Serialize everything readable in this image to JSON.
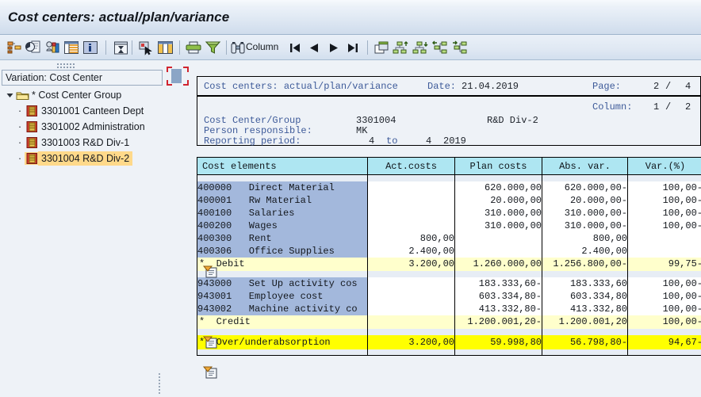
{
  "window": {
    "title": "Cost centers: actual/plan/variance"
  },
  "toolbar": {
    "icons": [
      {
        "name": "hierarchy-icon",
        "label": ""
      },
      {
        "name": "variation-icon",
        "label": ""
      },
      {
        "name": "report-structure-icon",
        "label": ""
      },
      {
        "name": "table-icon",
        "label": ""
      },
      {
        "name": "info-icon",
        "label": ""
      },
      {
        "name": "sort-filter-icon",
        "label": ""
      },
      {
        "name": "select-cursor-icon",
        "label": ""
      },
      {
        "name": "columns-icon",
        "label": ""
      },
      {
        "name": "print-icon",
        "label": ""
      },
      {
        "name": "filter-funnel-icon",
        "label": ""
      },
      {
        "name": "find-binoculars-icon",
        "label": "Column"
      },
      {
        "name": "first-page-icon",
        "label": ""
      },
      {
        "name": "previous-page-icon",
        "label": ""
      },
      {
        "name": "next-page-icon",
        "label": ""
      },
      {
        "name": "last-page-icon",
        "label": ""
      },
      {
        "name": "new-window-icon",
        "label": ""
      },
      {
        "name": "expand-up-icon",
        "label": ""
      },
      {
        "name": "collapse-down-icon",
        "label": ""
      },
      {
        "name": "navigate-left-icon",
        "label": ""
      },
      {
        "name": "navigate-right-icon",
        "label": ""
      }
    ],
    "find_label": "Column"
  },
  "sidebar": {
    "header": "Variation: Cost Center",
    "root": {
      "label": "* Cost Center Group",
      "expanded": true
    },
    "items": [
      {
        "id": "3301001",
        "label": "3301001 Canteen Dept",
        "selected": false
      },
      {
        "id": "3301002",
        "label": "3301002 Administration",
        "selected": false
      },
      {
        "id": "3301003",
        "label": "3301003 R&D Div-1",
        "selected": false
      },
      {
        "id": "3301004",
        "label": "3301004 R&D Div-2",
        "selected": true
      }
    ]
  },
  "report_header": {
    "title": "Cost centers: actual/plan/variance",
    "date_label": "Date:",
    "date_value": "21.04.2019",
    "page_label": "Page:",
    "page_current": "2",
    "page_sep": "/",
    "page_total": "4",
    "column_label": "Column:",
    "column_current": "1",
    "column_sep": "/",
    "column_total": "2",
    "cost_center_label": "Cost Center/Group",
    "cost_center_value": "3301004",
    "cost_center_name": "R&D Div-2",
    "person_label": "Person responsible:",
    "person_value": "MK",
    "period_label": "Reporting period:",
    "period_from": "4",
    "period_to_word": "to",
    "period_to": "4",
    "period_year": "2019"
  },
  "table": {
    "columns": [
      "Cost elements",
      "Act.costs",
      "Plan costs",
      "Abs. var.",
      "Var.(%)"
    ],
    "groups": [
      {
        "rows": [
          {
            "code": "400000",
            "name": "Direct Material",
            "act": "",
            "plan": "620.000,00",
            "abs": "620.000,00-",
            "var": "100,00-"
          },
          {
            "code": "400001",
            "name": "Rw Material",
            "act": "",
            "plan": "20.000,00",
            "abs": "20.000,00-",
            "var": "100,00-"
          },
          {
            "code": "400100",
            "name": "Salaries",
            "act": "",
            "plan": "310.000,00",
            "abs": "310.000,00-",
            "var": "100,00-"
          },
          {
            "code": "400200",
            "name": "Wages",
            "act": "",
            "plan": "310.000,00",
            "abs": "310.000,00-",
            "var": "100,00-"
          },
          {
            "code": "400300",
            "name": "Rent",
            "act": "800,00",
            "plan": "",
            "abs": "800,00",
            "var": ""
          },
          {
            "code": "400306",
            "name": "Office Supplies",
            "act": "2.400,00",
            "plan": "",
            "abs": "2.400,00",
            "var": ""
          }
        ],
        "total": {
          "marker": "*",
          "name": "Debit",
          "act": "3.200,00",
          "plan": "1.260.000,00",
          "abs": "1.256.800,00-",
          "var": "99,75-"
        }
      },
      {
        "rows": [
          {
            "code": "943000",
            "name": "Set Up activity cos",
            "act": "",
            "plan": "183.333,60-",
            "abs": "183.333,60",
            "var": "100,00-"
          },
          {
            "code": "943001",
            "name": "Employee cost",
            "act": "",
            "plan": "603.334,80-",
            "abs": "603.334,80",
            "var": "100,00-"
          },
          {
            "code": "943002",
            "name": "Machine activity co",
            "act": "",
            "plan": "413.332,80-",
            "abs": "413.332,80",
            "var": "100,00-"
          }
        ],
        "total": {
          "marker": "*",
          "name": "Credit",
          "act": "",
          "plan": "1.200.001,20-",
          "abs": "1.200.001,20",
          "var": "100,00-"
        }
      }
    ],
    "grand_total": {
      "marker": "**",
      "name": "Over/underabsorption",
      "act": "3.200,00",
      "plan": "59.998,80",
      "abs": "56.798,80-",
      "var": "94,67-"
    }
  },
  "colors": {
    "header_cell": "#aee6f2",
    "name_cell": "#a3b8dc",
    "subtotal": "#ffffcc",
    "grandtotal": "#ffff00",
    "selection": "#ffd98a",
    "accent_blue": "#3d5a99"
  }
}
